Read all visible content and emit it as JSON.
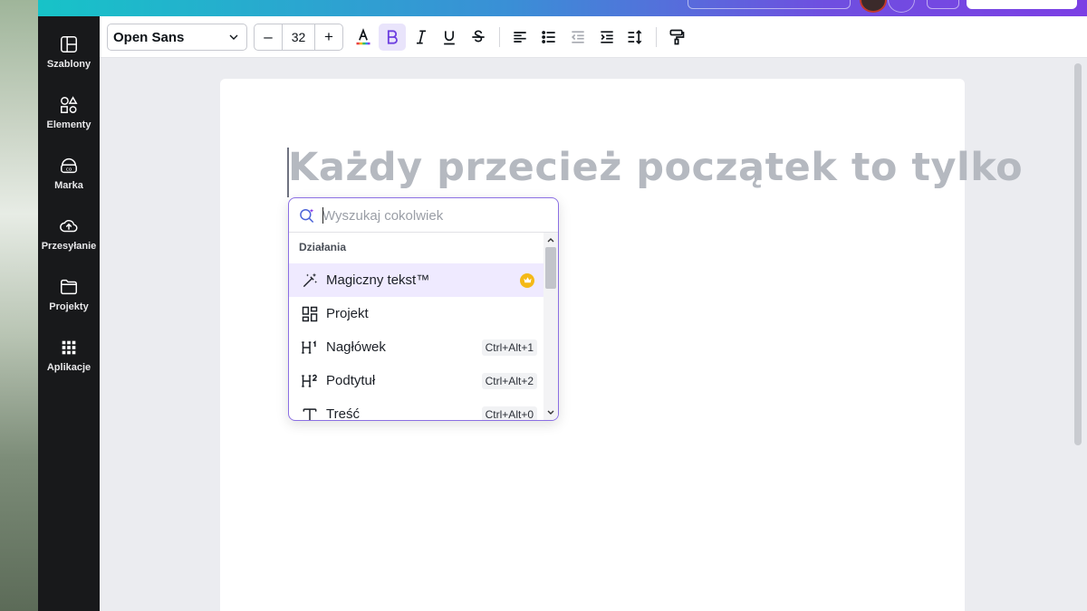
{
  "colors": {
    "accent": "#7d2ae8",
    "sidebar_bg": "#18191b",
    "canvas_bg": "#ebecf0",
    "highlight_row": "#efeaff",
    "premium_crown": "#f4b917"
  },
  "sidebar": {
    "items": [
      {
        "label": "Szablony",
        "icon": "templates-icon"
      },
      {
        "label": "Elementy",
        "icon": "elements-icon"
      },
      {
        "label": "Marka",
        "icon": "brand-icon"
      },
      {
        "label": "Przesyłanie",
        "icon": "upload-icon"
      },
      {
        "label": "Projekty",
        "icon": "folder-icon"
      },
      {
        "label": "Aplikacje",
        "icon": "apps-grid-icon"
      }
    ]
  },
  "toolbar": {
    "font_family": "Open Sans",
    "font_size": "32",
    "decrease_label": "–",
    "increase_label": "+",
    "buttons": [
      "text-color-icon",
      "bold-icon",
      "italic-icon",
      "underline-icon",
      "strikethrough-icon",
      "align-left-icon",
      "bulleted-list-icon",
      "indent-decrease-icon",
      "indent-increase-icon",
      "line-spacing-icon",
      "paint-format-icon"
    ],
    "bold_active": true
  },
  "canvas": {
    "text": "Każdy przecież początek to tylko"
  },
  "popup": {
    "search_placeholder": "Wyszukaj cokolwiek",
    "section_title": "Działania",
    "items": [
      {
        "label": "Magiczny tekst™",
        "icon": "magic-wand-icon",
        "shortcut": "",
        "premium": true
      },
      {
        "label": "Projekt",
        "icon": "design-grid-icon",
        "shortcut": ""
      },
      {
        "label": "Nagłówek",
        "icon": "heading-1-icon",
        "shortcut": "Ctrl+Alt+1"
      },
      {
        "label": "Podtytuł",
        "icon": "heading-2-icon",
        "shortcut": "Ctrl+Alt+2"
      },
      {
        "label": "Treść",
        "icon": "body-text-icon",
        "shortcut": "Ctrl+Alt+0"
      }
    ]
  }
}
